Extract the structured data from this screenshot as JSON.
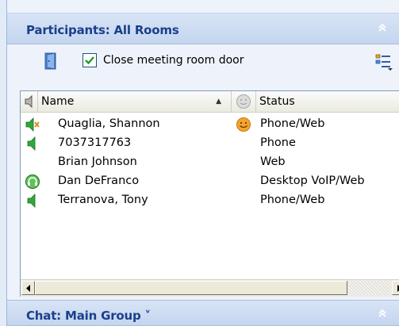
{
  "participants_panel": {
    "title": "Participants: All Rooms",
    "collapse_glyph": "»",
    "close_door_checkbox": {
      "label": "Close meeting room door",
      "checked": true
    },
    "columns": {
      "name": "Name",
      "status": "Status",
      "sort_indicator": "▲"
    },
    "rows": [
      {
        "name": "Quaglia, Shannon",
        "status": "Phone/Web",
        "speaker_icon": "speaker-muted-icon",
        "mood_icon": "smiley-icon"
      },
      {
        "name": "7037317763",
        "status": "Phone",
        "speaker_icon": "speaker-icon",
        "mood_icon": ""
      },
      {
        "name": "Brian Johnson",
        "status": "Web",
        "speaker_icon": "",
        "mood_icon": ""
      },
      {
        "name": "Dan DeFranco",
        "status": "Desktop VoIP/Web",
        "speaker_icon": "voip-headset-icon",
        "mood_icon": ""
      },
      {
        "name": "Terranova, Tony",
        "status": "Phone/Web",
        "speaker_icon": "speaker-icon",
        "mood_icon": ""
      }
    ]
  },
  "chat_panel": {
    "title": "Chat: Main Group ˅",
    "collapse_glyph": "»"
  },
  "colors": {
    "header_text": "#1a3f8c",
    "checkbox_check": "#1e9e2d",
    "speaker_green": "#2fa83a",
    "smiley": "#f3a52b"
  }
}
